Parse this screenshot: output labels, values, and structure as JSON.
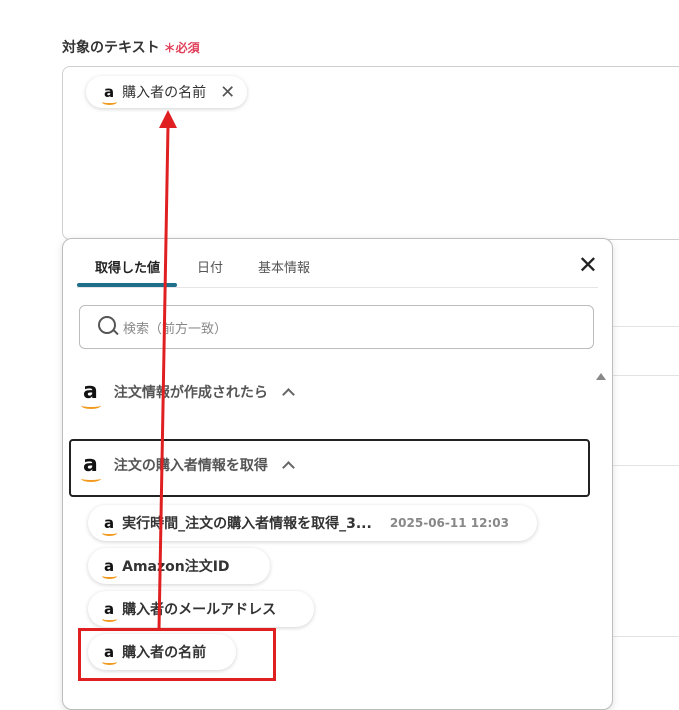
{
  "field": {
    "label": "対象のテキスト",
    "required": "＊必須",
    "selected_chip": "購入者の名前"
  },
  "panel": {
    "tabs": [
      "取得した値",
      "日付",
      "基本情報"
    ],
    "search_placeholder": "検索（前方一致）",
    "groups": [
      "注文情報が作成されたら",
      "注文の購入者情報を取得"
    ],
    "items": [
      {
        "label": "実行時間_注文の購入者情報を取得_3...",
        "time": "2025-06-11 12:03"
      },
      {
        "label": "Amazon注文ID"
      },
      {
        "label": "購入者のメールアドレス"
      },
      {
        "label": "購入者の名前"
      }
    ]
  },
  "colors": {
    "accent_tab": "#1f6f8b",
    "annotation_red": "#e02020",
    "required": "#e0405a",
    "amazon_smile": "#f29a1e"
  },
  "icons": [
    "amazon-logo-icon",
    "close-icon",
    "search-icon",
    "chevron-up-icon",
    "scroll-up-icon"
  ]
}
